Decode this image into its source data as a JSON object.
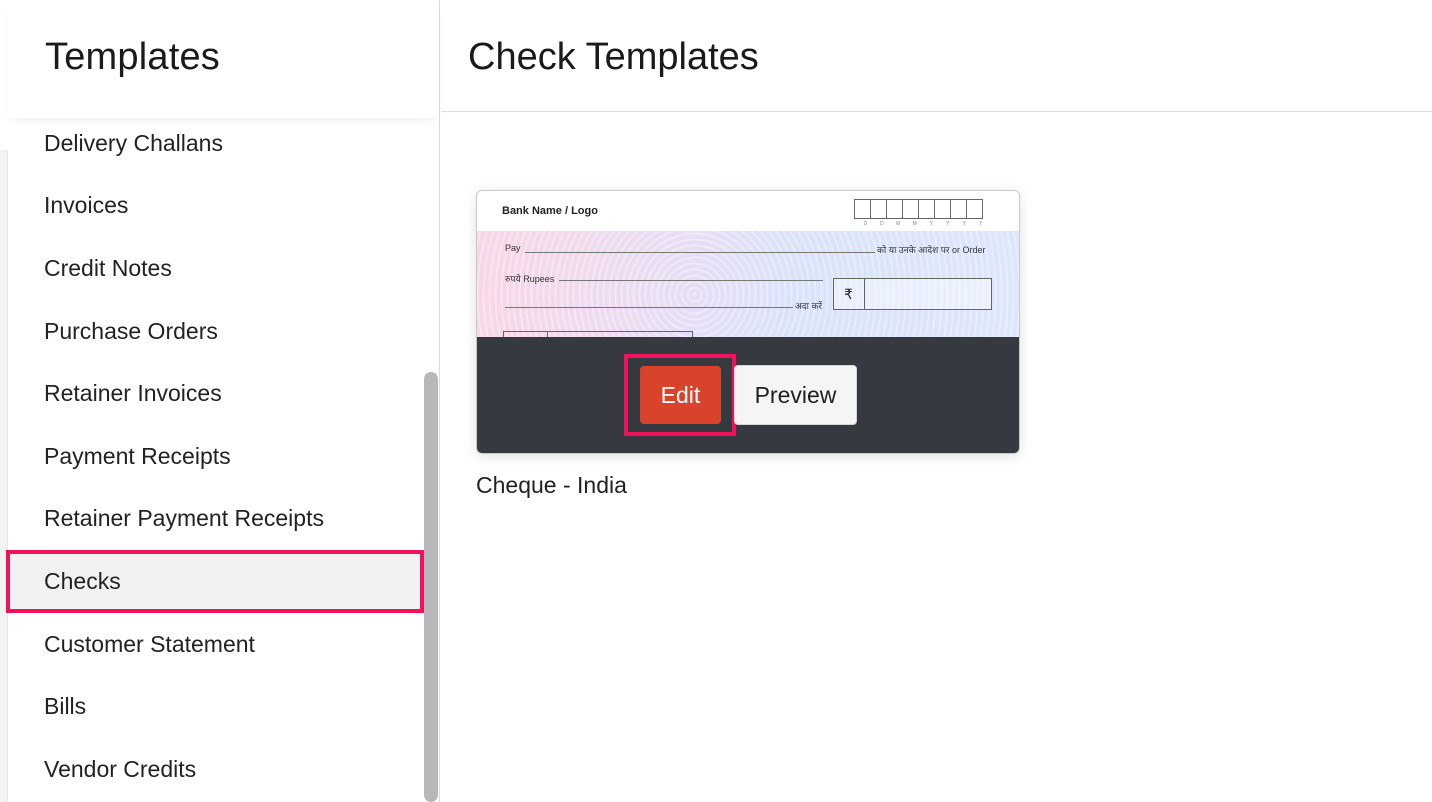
{
  "sidebar": {
    "title": "Templates",
    "items": [
      {
        "label": "Delivery Challans"
      },
      {
        "label": "Invoices"
      },
      {
        "label": "Credit Notes"
      },
      {
        "label": "Purchase Orders"
      },
      {
        "label": "Retainer Invoices"
      },
      {
        "label": "Payment Receipts"
      },
      {
        "label": "Retainer Payment Receipts"
      },
      {
        "label": "Checks",
        "active": true
      },
      {
        "label": "Customer Statement"
      },
      {
        "label": "Bills"
      },
      {
        "label": "Vendor Credits"
      }
    ]
  },
  "main": {
    "title": "Check Templates",
    "template": {
      "name": "Cheque - India",
      "preview": {
        "bank": "Bank Name / Logo",
        "date_letters": [
          "D",
          "D",
          "M",
          "M",
          "Y",
          "Y",
          "Y",
          "Y"
        ],
        "pay": "Pay",
        "order": "को या उनके आदेश पर or Order",
        "rupees": "रुपये Rupees",
        "pay_to": "अदा करें",
        "currency": "₹"
      },
      "edit_label": "Edit",
      "preview_label": "Preview"
    }
  },
  "colors": {
    "highlight": "#f0135b",
    "edit_button": "#d9432c",
    "overlay": "#363a40"
  }
}
